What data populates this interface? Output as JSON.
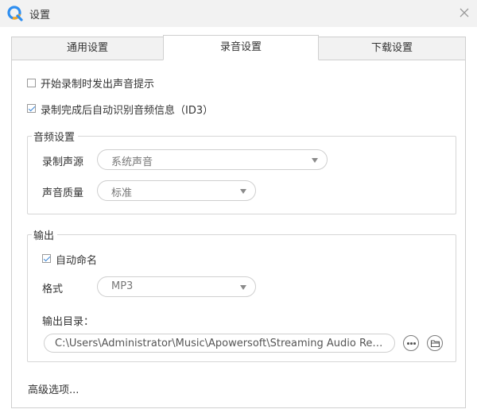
{
  "window": {
    "title": "设置",
    "app_icon": "apowersoft-q-logo-icon",
    "close_icon": "close-icon"
  },
  "tabs": [
    {
      "label": "通用设置",
      "active": false
    },
    {
      "label": "录音设置",
      "active": true
    },
    {
      "label": "下载设置",
      "active": false
    }
  ],
  "options": {
    "sound_prompt": {
      "label": "开始录制时发出声音提示",
      "checked": false
    },
    "auto_identify": {
      "label": "录制完成后自动识别音频信息（ID3）",
      "checked": true
    }
  },
  "audio_group": {
    "title": "音频设置",
    "source": {
      "label": "录制声源",
      "value": "系统声音"
    },
    "quality": {
      "label": "声音质量",
      "value": "标准"
    }
  },
  "output_group": {
    "title": "输出",
    "auto_name": {
      "label": "自动命名",
      "checked": true
    },
    "format": {
      "label": "格式",
      "value": "MP3"
    },
    "directory": {
      "label": "输出目录：",
      "value": "C:\\Users\\Administrator\\Music\\Apowersoft\\Streaming Audio Recorder",
      "browse_icon": "more-dots-icon",
      "open_folder_icon": "folder-icon"
    }
  },
  "advanced_label": "高级选项...",
  "colors": {
    "accent": "#3a86d6",
    "titlebar_bg": "#f2f2f2",
    "border": "#cfcfcf"
  }
}
